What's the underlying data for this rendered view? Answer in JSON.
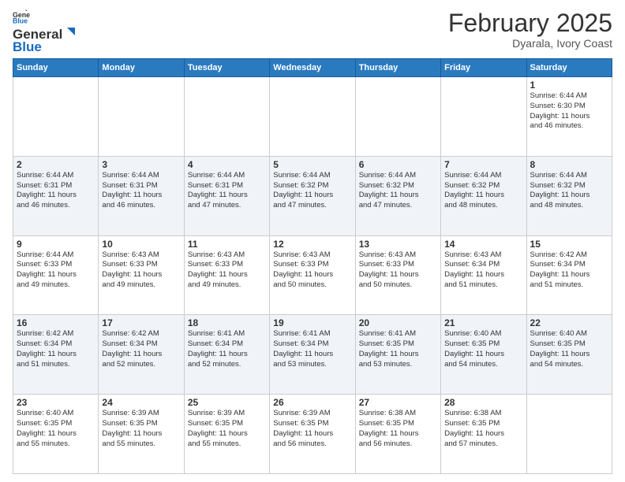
{
  "header": {
    "logo_general": "General",
    "logo_blue": "Blue",
    "month": "February 2025",
    "location": "Dyarala, Ivory Coast"
  },
  "weekdays": [
    "Sunday",
    "Monday",
    "Tuesday",
    "Wednesday",
    "Thursday",
    "Friday",
    "Saturday"
  ],
  "weeks": [
    [
      {
        "day": "",
        "info": ""
      },
      {
        "day": "",
        "info": ""
      },
      {
        "day": "",
        "info": ""
      },
      {
        "day": "",
        "info": ""
      },
      {
        "day": "",
        "info": ""
      },
      {
        "day": "",
        "info": ""
      },
      {
        "day": "1",
        "info": "Sunrise: 6:44 AM\nSunset: 6:30 PM\nDaylight: 11 hours\nand 46 minutes."
      }
    ],
    [
      {
        "day": "2",
        "info": "Sunrise: 6:44 AM\nSunset: 6:31 PM\nDaylight: 11 hours\nand 46 minutes."
      },
      {
        "day": "3",
        "info": "Sunrise: 6:44 AM\nSunset: 6:31 PM\nDaylight: 11 hours\nand 46 minutes."
      },
      {
        "day": "4",
        "info": "Sunrise: 6:44 AM\nSunset: 6:31 PM\nDaylight: 11 hours\nand 47 minutes."
      },
      {
        "day": "5",
        "info": "Sunrise: 6:44 AM\nSunset: 6:32 PM\nDaylight: 11 hours\nand 47 minutes."
      },
      {
        "day": "6",
        "info": "Sunrise: 6:44 AM\nSunset: 6:32 PM\nDaylight: 11 hours\nand 47 minutes."
      },
      {
        "day": "7",
        "info": "Sunrise: 6:44 AM\nSunset: 6:32 PM\nDaylight: 11 hours\nand 48 minutes."
      },
      {
        "day": "8",
        "info": "Sunrise: 6:44 AM\nSunset: 6:32 PM\nDaylight: 11 hours\nand 48 minutes."
      }
    ],
    [
      {
        "day": "9",
        "info": "Sunrise: 6:44 AM\nSunset: 6:33 PM\nDaylight: 11 hours\nand 49 minutes."
      },
      {
        "day": "10",
        "info": "Sunrise: 6:43 AM\nSunset: 6:33 PM\nDaylight: 11 hours\nand 49 minutes."
      },
      {
        "day": "11",
        "info": "Sunrise: 6:43 AM\nSunset: 6:33 PM\nDaylight: 11 hours\nand 49 minutes."
      },
      {
        "day": "12",
        "info": "Sunrise: 6:43 AM\nSunset: 6:33 PM\nDaylight: 11 hours\nand 50 minutes."
      },
      {
        "day": "13",
        "info": "Sunrise: 6:43 AM\nSunset: 6:33 PM\nDaylight: 11 hours\nand 50 minutes."
      },
      {
        "day": "14",
        "info": "Sunrise: 6:43 AM\nSunset: 6:34 PM\nDaylight: 11 hours\nand 51 minutes."
      },
      {
        "day": "15",
        "info": "Sunrise: 6:42 AM\nSunset: 6:34 PM\nDaylight: 11 hours\nand 51 minutes."
      }
    ],
    [
      {
        "day": "16",
        "info": "Sunrise: 6:42 AM\nSunset: 6:34 PM\nDaylight: 11 hours\nand 51 minutes."
      },
      {
        "day": "17",
        "info": "Sunrise: 6:42 AM\nSunset: 6:34 PM\nDaylight: 11 hours\nand 52 minutes."
      },
      {
        "day": "18",
        "info": "Sunrise: 6:41 AM\nSunset: 6:34 PM\nDaylight: 11 hours\nand 52 minutes."
      },
      {
        "day": "19",
        "info": "Sunrise: 6:41 AM\nSunset: 6:34 PM\nDaylight: 11 hours\nand 53 minutes."
      },
      {
        "day": "20",
        "info": "Sunrise: 6:41 AM\nSunset: 6:35 PM\nDaylight: 11 hours\nand 53 minutes."
      },
      {
        "day": "21",
        "info": "Sunrise: 6:40 AM\nSunset: 6:35 PM\nDaylight: 11 hours\nand 54 minutes."
      },
      {
        "day": "22",
        "info": "Sunrise: 6:40 AM\nSunset: 6:35 PM\nDaylight: 11 hours\nand 54 minutes."
      }
    ],
    [
      {
        "day": "23",
        "info": "Sunrise: 6:40 AM\nSunset: 6:35 PM\nDaylight: 11 hours\nand 55 minutes."
      },
      {
        "day": "24",
        "info": "Sunrise: 6:39 AM\nSunset: 6:35 PM\nDaylight: 11 hours\nand 55 minutes."
      },
      {
        "day": "25",
        "info": "Sunrise: 6:39 AM\nSunset: 6:35 PM\nDaylight: 11 hours\nand 55 minutes."
      },
      {
        "day": "26",
        "info": "Sunrise: 6:39 AM\nSunset: 6:35 PM\nDaylight: 11 hours\nand 56 minutes."
      },
      {
        "day": "27",
        "info": "Sunrise: 6:38 AM\nSunset: 6:35 PM\nDaylight: 11 hours\nand 56 minutes."
      },
      {
        "day": "28",
        "info": "Sunrise: 6:38 AM\nSunset: 6:35 PM\nDaylight: 11 hours\nand 57 minutes."
      },
      {
        "day": "",
        "info": ""
      }
    ]
  ]
}
